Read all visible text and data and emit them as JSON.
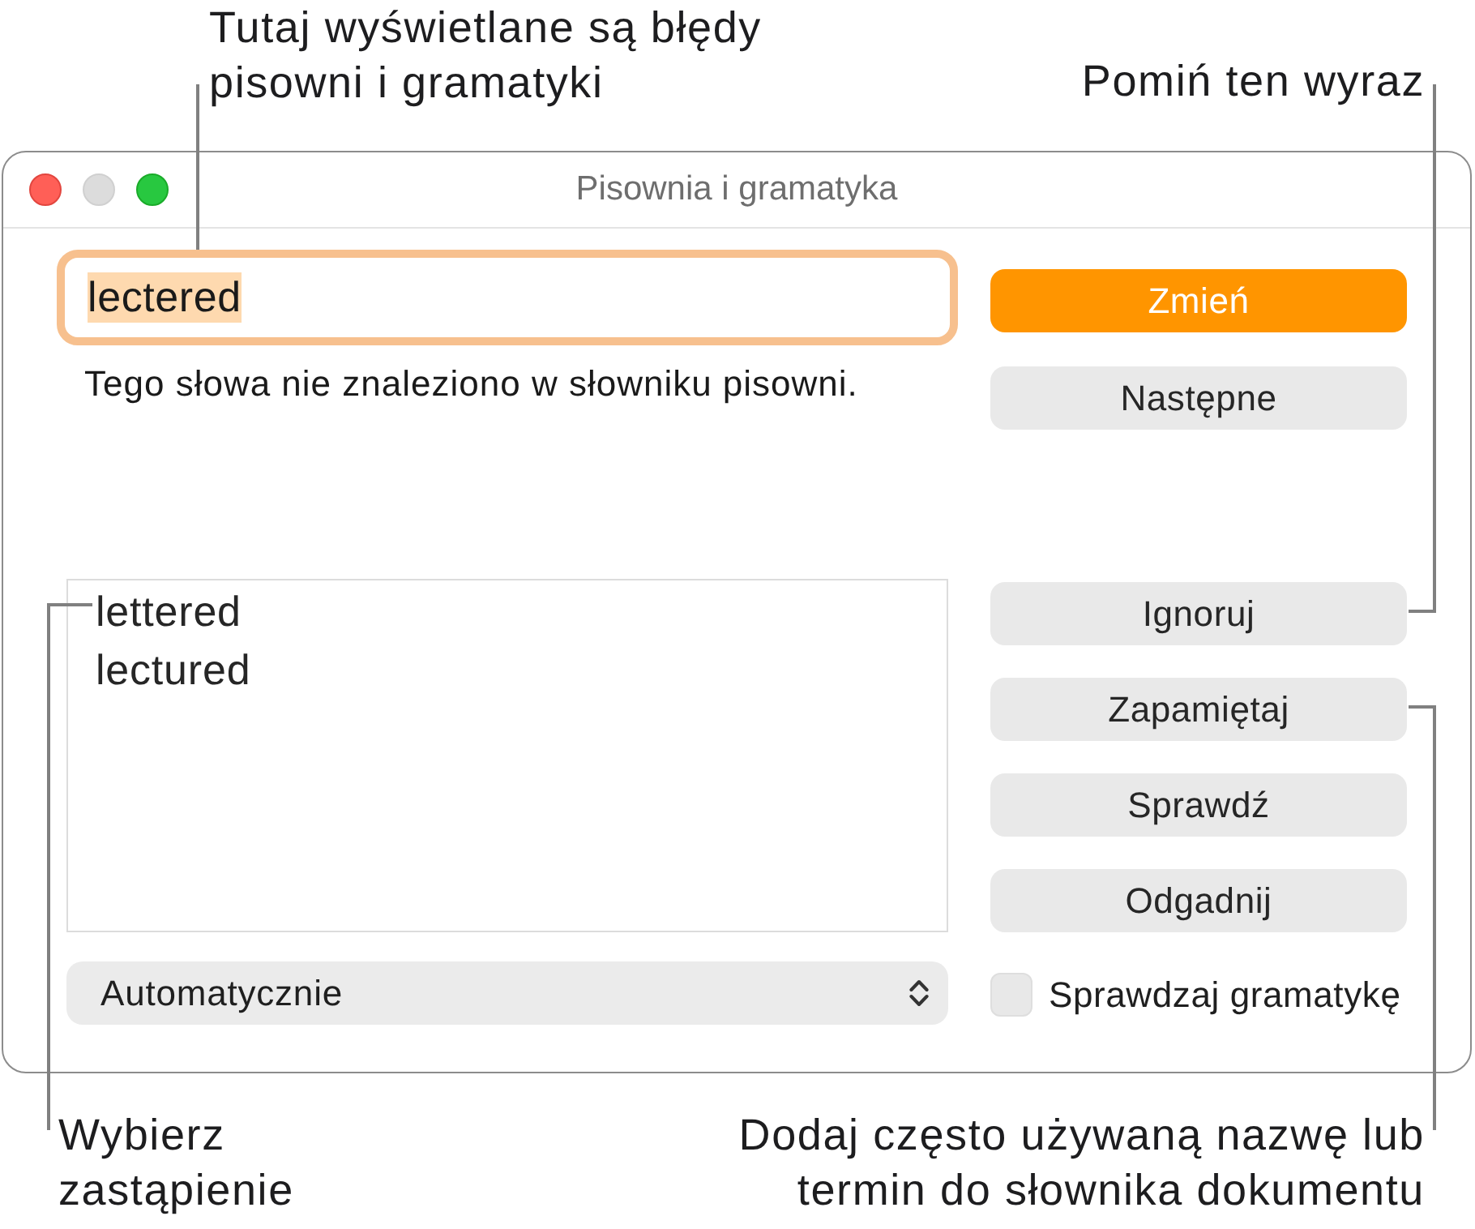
{
  "callouts_top": [
    {
      "lines": [
        "Tutaj wyświetlane są błędy",
        "pisowni i gramatyki"
      ]
    },
    {
      "lines": [
        "Pomiń ten wyraz"
      ]
    }
  ],
  "window": {
    "title": "Pisownia i gramatyka",
    "controls": [
      {
        "kind": "close",
        "disabled": false
      },
      {
        "kind": "minimize",
        "disabled": true
      },
      {
        "kind": "zoom",
        "disabled": false
      }
    ]
  },
  "word_field": {
    "value": "lectered",
    "focused": true,
    "text_selected": true
  },
  "message": "Tego słowa nie znaleziono w słowniku pisowni.",
  "suggestions": [
    {
      "label": "lettered",
      "selected": false
    },
    {
      "label": "lectured",
      "selected": false
    }
  ],
  "dictionary_popup": {
    "value": "Automatycznie"
  },
  "buttons_top": [
    {
      "label": "Zmień",
      "kind": "default"
    },
    {
      "label": "Następne",
      "kind": "normal"
    }
  ],
  "buttons_bottom": [
    {
      "label": "Ignoruj",
      "kind": "normal"
    },
    {
      "label": "Zapamiętaj",
      "kind": "normal"
    },
    {
      "label": "Sprawdź",
      "kind": "normal"
    },
    {
      "label": "Odgadnij",
      "kind": "normal"
    }
  ],
  "grammar_checkbox": {
    "label": "Sprawdzaj gramatykę",
    "checked": false
  },
  "callouts_bottom": [
    {
      "lines": [
        "Wybierz",
        "zastąpienie"
      ]
    },
    {
      "lines": [
        "Dodaj często używaną nazwę lub",
        "termin do słownika dokumentu"
      ]
    }
  ]
}
